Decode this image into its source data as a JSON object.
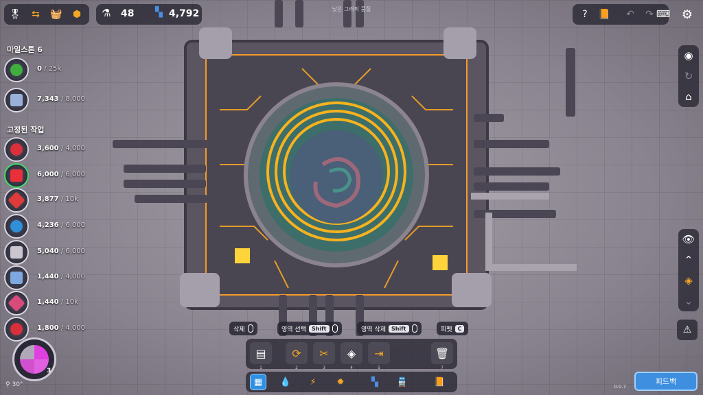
{
  "topbar": {
    "icons": [
      "ribbon-icon",
      "share-icon",
      "basket-icon",
      "badge-icon"
    ],
    "research_count": "48",
    "shape_count": "4,792",
    "quality_notice": "낮은 그래픽 품질"
  },
  "sidebar": {
    "milestone_title": "마일스톤 6",
    "milestones": [
      {
        "current": "0",
        "total": " / 25k"
      },
      {
        "current": "7,343",
        "total": " / 8,000"
      }
    ],
    "pinned_title": "고정된 작업",
    "pinned": [
      {
        "current": "3,600",
        "total": " / 4,000"
      },
      {
        "current": "6,000",
        "total": " / 6,000"
      },
      {
        "current": "3,877",
        "total": " / 10k"
      },
      {
        "current": "4,236",
        "total": " / 6,000"
      },
      {
        "current": "5,040",
        "total": " / 6,000"
      },
      {
        "current": "1,440",
        "total": " / 4,000"
      },
      {
        "current": "1,440",
        "total": " / 10k"
      },
      {
        "current": "1,800",
        "total": " / 4,000"
      }
    ]
  },
  "hints": {
    "delete": "삭제",
    "area_select": "영역 선택",
    "area_delete": "영역 삭제",
    "shift_key": "Shift",
    "pipette": "피펫",
    "pipette_key": "C"
  },
  "toolbar": {
    "slots": [
      "1",
      "2",
      "3",
      "4",
      "5",
      "7"
    ]
  },
  "minimap": {
    "layer": "3",
    "zoom": "30°"
  },
  "feedback_label": "피드백",
  "version": "0.0.7",
  "colors": {
    "accent": "#f5a623",
    "feedback": "#3f8fe0",
    "panel": "#28263 2"
  }
}
